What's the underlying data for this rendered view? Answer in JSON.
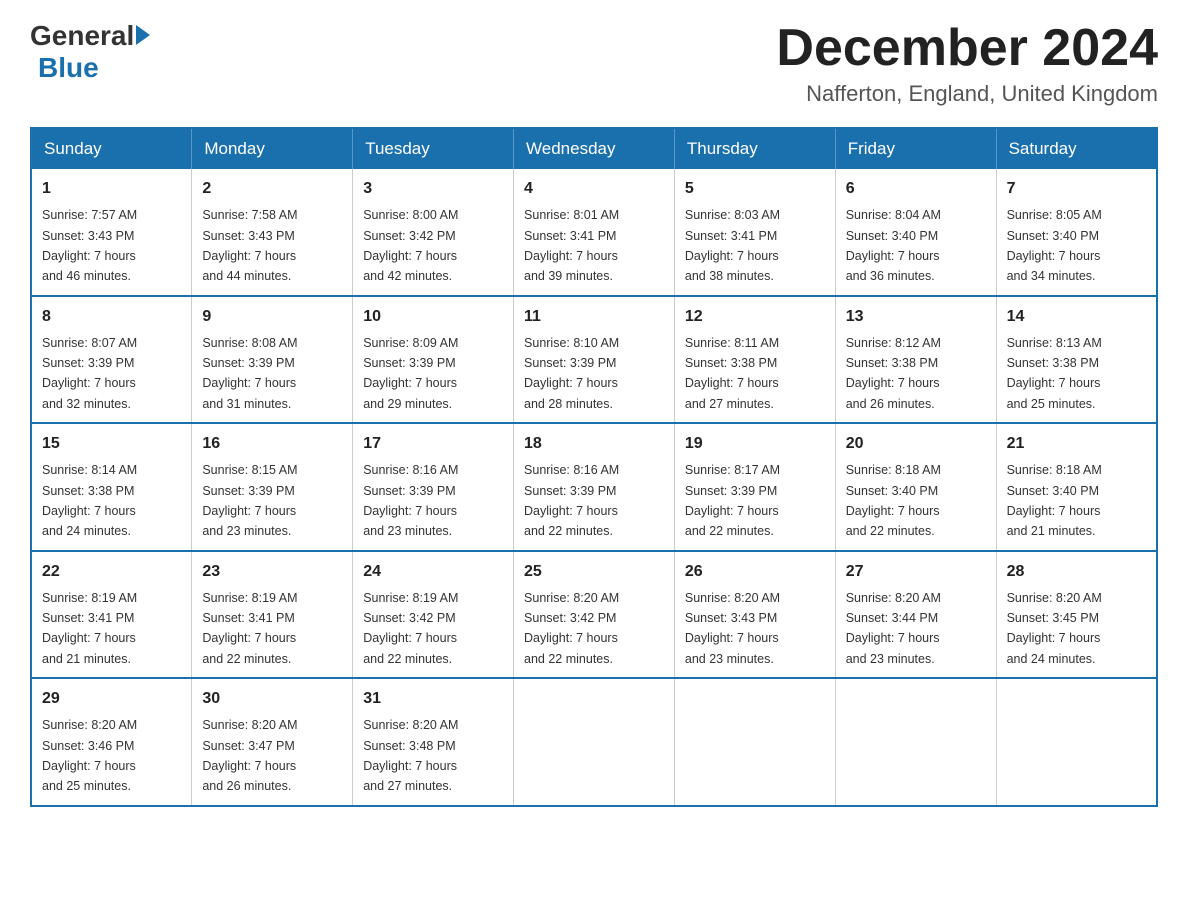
{
  "header": {
    "logo_general": "General",
    "logo_blue": "Blue",
    "month_title": "December 2024",
    "location": "Nafferton, England, United Kingdom"
  },
  "weekdays": [
    "Sunday",
    "Monday",
    "Tuesday",
    "Wednesday",
    "Thursday",
    "Friday",
    "Saturday"
  ],
  "weeks": [
    [
      {
        "day": "1",
        "sunrise": "7:57 AM",
        "sunset": "3:43 PM",
        "daylight": "7 hours and 46 minutes."
      },
      {
        "day": "2",
        "sunrise": "7:58 AM",
        "sunset": "3:43 PM",
        "daylight": "7 hours and 44 minutes."
      },
      {
        "day": "3",
        "sunrise": "8:00 AM",
        "sunset": "3:42 PM",
        "daylight": "7 hours and 42 minutes."
      },
      {
        "day": "4",
        "sunrise": "8:01 AM",
        "sunset": "3:41 PM",
        "daylight": "7 hours and 39 minutes."
      },
      {
        "day": "5",
        "sunrise": "8:03 AM",
        "sunset": "3:41 PM",
        "daylight": "7 hours and 38 minutes."
      },
      {
        "day": "6",
        "sunrise": "8:04 AM",
        "sunset": "3:40 PM",
        "daylight": "7 hours and 36 minutes."
      },
      {
        "day": "7",
        "sunrise": "8:05 AM",
        "sunset": "3:40 PM",
        "daylight": "7 hours and 34 minutes."
      }
    ],
    [
      {
        "day": "8",
        "sunrise": "8:07 AM",
        "sunset": "3:39 PM",
        "daylight": "7 hours and 32 minutes."
      },
      {
        "day": "9",
        "sunrise": "8:08 AM",
        "sunset": "3:39 PM",
        "daylight": "7 hours and 31 minutes."
      },
      {
        "day": "10",
        "sunrise": "8:09 AM",
        "sunset": "3:39 PM",
        "daylight": "7 hours and 29 minutes."
      },
      {
        "day": "11",
        "sunrise": "8:10 AM",
        "sunset": "3:39 PM",
        "daylight": "7 hours and 28 minutes."
      },
      {
        "day": "12",
        "sunrise": "8:11 AM",
        "sunset": "3:38 PM",
        "daylight": "7 hours and 27 minutes."
      },
      {
        "day": "13",
        "sunrise": "8:12 AM",
        "sunset": "3:38 PM",
        "daylight": "7 hours and 26 minutes."
      },
      {
        "day": "14",
        "sunrise": "8:13 AM",
        "sunset": "3:38 PM",
        "daylight": "7 hours and 25 minutes."
      }
    ],
    [
      {
        "day": "15",
        "sunrise": "8:14 AM",
        "sunset": "3:38 PM",
        "daylight": "7 hours and 24 minutes."
      },
      {
        "day": "16",
        "sunrise": "8:15 AM",
        "sunset": "3:39 PM",
        "daylight": "7 hours and 23 minutes."
      },
      {
        "day": "17",
        "sunrise": "8:16 AM",
        "sunset": "3:39 PM",
        "daylight": "7 hours and 23 minutes."
      },
      {
        "day": "18",
        "sunrise": "8:16 AM",
        "sunset": "3:39 PM",
        "daylight": "7 hours and 22 minutes."
      },
      {
        "day": "19",
        "sunrise": "8:17 AM",
        "sunset": "3:39 PM",
        "daylight": "7 hours and 22 minutes."
      },
      {
        "day": "20",
        "sunrise": "8:18 AM",
        "sunset": "3:40 PM",
        "daylight": "7 hours and 22 minutes."
      },
      {
        "day": "21",
        "sunrise": "8:18 AM",
        "sunset": "3:40 PM",
        "daylight": "7 hours and 21 minutes."
      }
    ],
    [
      {
        "day": "22",
        "sunrise": "8:19 AM",
        "sunset": "3:41 PM",
        "daylight": "7 hours and 21 minutes."
      },
      {
        "day": "23",
        "sunrise": "8:19 AM",
        "sunset": "3:41 PM",
        "daylight": "7 hours and 22 minutes."
      },
      {
        "day": "24",
        "sunrise": "8:19 AM",
        "sunset": "3:42 PM",
        "daylight": "7 hours and 22 minutes."
      },
      {
        "day": "25",
        "sunrise": "8:20 AM",
        "sunset": "3:42 PM",
        "daylight": "7 hours and 22 minutes."
      },
      {
        "day": "26",
        "sunrise": "8:20 AM",
        "sunset": "3:43 PM",
        "daylight": "7 hours and 23 minutes."
      },
      {
        "day": "27",
        "sunrise": "8:20 AM",
        "sunset": "3:44 PM",
        "daylight": "7 hours and 23 minutes."
      },
      {
        "day": "28",
        "sunrise": "8:20 AM",
        "sunset": "3:45 PM",
        "daylight": "7 hours and 24 minutes."
      }
    ],
    [
      {
        "day": "29",
        "sunrise": "8:20 AM",
        "sunset": "3:46 PM",
        "daylight": "7 hours and 25 minutes."
      },
      {
        "day": "30",
        "sunrise": "8:20 AM",
        "sunset": "3:47 PM",
        "daylight": "7 hours and 26 minutes."
      },
      {
        "day": "31",
        "sunrise": "8:20 AM",
        "sunset": "3:48 PM",
        "daylight": "7 hours and 27 minutes."
      },
      null,
      null,
      null,
      null
    ]
  ],
  "labels": {
    "sunrise": "Sunrise:",
    "sunset": "Sunset:",
    "daylight": "Daylight:"
  }
}
